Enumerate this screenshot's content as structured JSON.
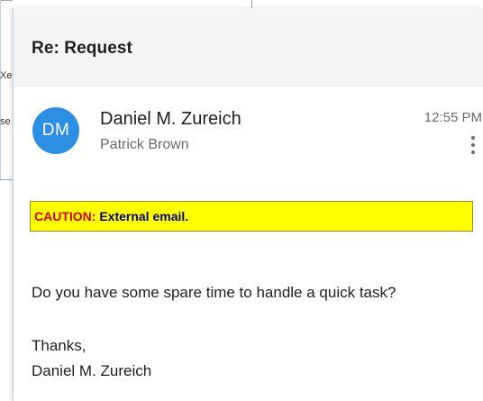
{
  "background_window": {
    "snippet_1": "Xe",
    "snippet_2": "se"
  },
  "email": {
    "subject": "Re: Request",
    "avatar_initials": "DM",
    "avatar_color": "#2d8fe3",
    "sender_name": "Daniel M. Zureich",
    "recipient": "Patrick Brown",
    "time": "12:55 PM",
    "more_icon": "more-vertical-icon",
    "caution": {
      "label": "CAUTION:",
      "text": " External email.",
      "background": "#ffff00",
      "label_color": "#d00000",
      "text_color": "#000080"
    },
    "body": {
      "question": "Do you have some spare time to handle a quick task?",
      "closing": "Thanks,",
      "signature": "Daniel M. Zureich"
    }
  }
}
